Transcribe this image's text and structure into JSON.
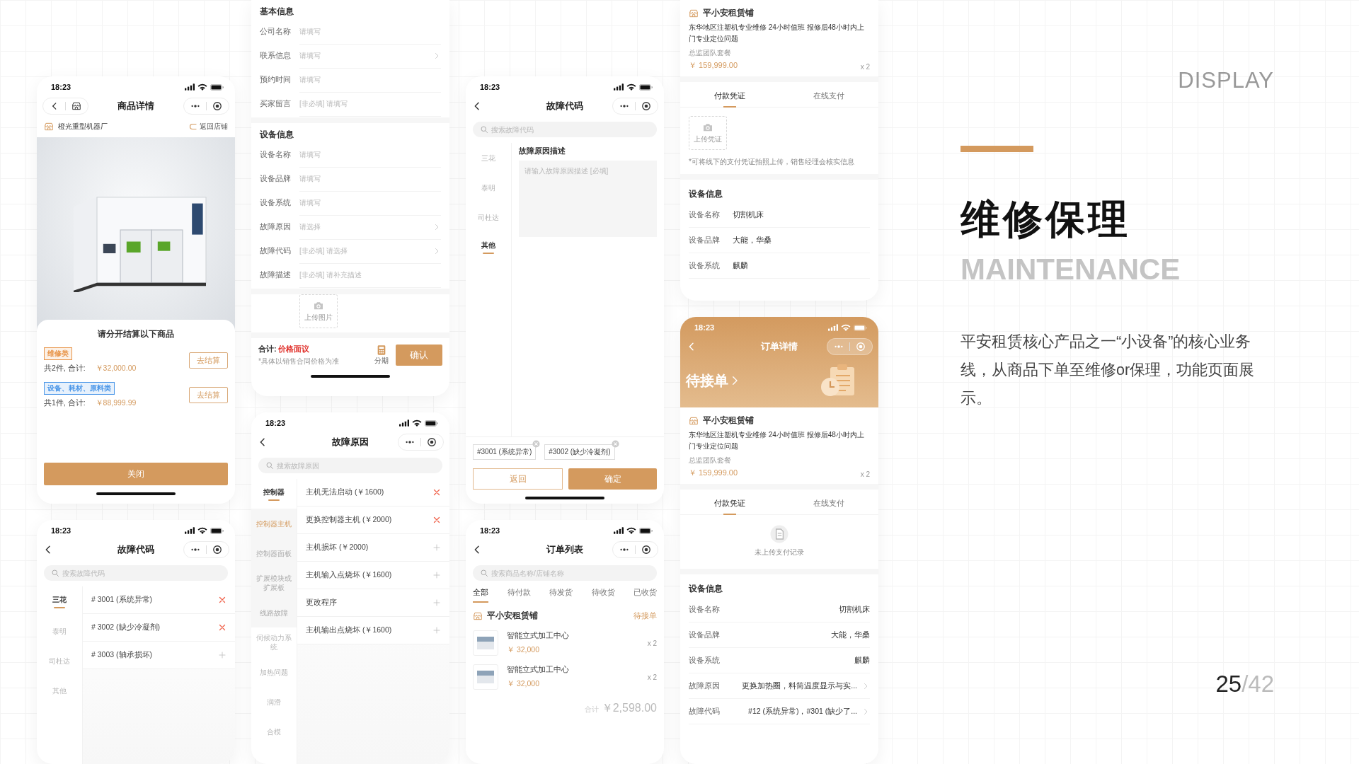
{
  "columns": [
    {
      "screens": [
        {
          "kind": "product_detail",
          "time": "18:23",
          "nav_title": "商品详情",
          "shop": "橙光重型机器厂",
          "back_link": "返回店铺",
          "sheet_title": "请分开结算以下商品",
          "groups": [
            {
              "tag": "维修类",
              "color": "#e8954a",
              "summary": "共2件, 合计:",
              "price": "￥32,000.00",
              "button": "去结算"
            },
            {
              "tag": "设备、耗材、原料类",
              "color": "#4a96e8",
              "summary": "共1件, 合计:",
              "price": "￥88,999.99",
              "button": "去结算"
            }
          ],
          "close": "关闭"
        },
        {
          "kind": "category_list",
          "time": "18:23",
          "nav_title": "故障代码",
          "search": {
            "placeholder": "搜索故障代码"
          },
          "categories": [
            {
              "label": "三花",
              "selected": true
            },
            {
              "label": "泰明",
              "selected": false
            },
            {
              "label": "司杜达",
              "selected": false
            },
            {
              "label": "其他",
              "selected": false
            }
          ],
          "items": [
            {
              "label": "# 3001 (系统异常)",
              "selected": true
            },
            {
              "label": "# 3002 (缺少冷凝剂)",
              "selected": true
            },
            {
              "label": "# 3003 (轴承损坏)",
              "selected": false
            }
          ]
        }
      ]
    },
    {
      "screens": [
        {
          "kind": "form",
          "sections": [
            {
              "title": "基本信息",
              "fields": [
                {
                  "label": "公司名称",
                  "placeholder": "请填写",
                  "arrow": false
                },
                {
                  "label": "联系信息",
                  "placeholder": "请填写",
                  "arrow": true
                },
                {
                  "label": "预约时间",
                  "placeholder": "请填写",
                  "arrow": false
                },
                {
                  "label": "买家留言",
                  "placeholder": "[非必填] 请填写",
                  "arrow": false
                }
              ]
            },
            {
              "title": "设备信息",
              "fields": [
                {
                  "label": "设备名称",
                  "placeholder": "请填写",
                  "arrow": false
                },
                {
                  "label": "设备品牌",
                  "placeholder": "请填写",
                  "arrow": false
                },
                {
                  "label": "设备系统",
                  "placeholder": "请填写",
                  "arrow": false
                },
                {
                  "label": "故障原因",
                  "placeholder": "请选择",
                  "arrow": true
                },
                {
                  "label": "故障代码",
                  "placeholder": "[非必填] 请选择",
                  "arrow": true
                },
                {
                  "label": "故障描述",
                  "placeholder": "[非必填] 请补充描述",
                  "arrow": false
                }
              ]
            }
          ],
          "upload": "上传图片",
          "total_label": "合计:",
          "total_value": "价格面议",
          "note": "*具体以销售合同价格为准",
          "installment": "分期",
          "confirm": "确认"
        },
        {
          "kind": "category_list",
          "time": "18:23",
          "nav_title": "故障原因",
          "search": {
            "placeholder": "搜索故障原因"
          },
          "categories": [
            {
              "label": "控制器",
              "selected": true,
              "children": [
                {
                  "label": "控制器主机",
                  "selected": true
                },
                {
                  "label": "控制器面板",
                  "selected": false
                },
                {
                  "label": "扩展模块或扩展板",
                  "selected": false
                },
                {
                  "label": "线路故障",
                  "selected": false
                }
              ]
            },
            {
              "label": "伺候动力系统",
              "selected": false
            },
            {
              "label": "加热问题",
              "selected": false
            },
            {
              "label": "润滑",
              "selected": false
            },
            {
              "label": "合模",
              "selected": false
            }
          ],
          "items": [
            {
              "label": "主机无法启动 (￥1600)",
              "selected": true
            },
            {
              "label": "更换控制器主机 (￥2000)",
              "selected": true
            },
            {
              "label": "主机损坏 (￥2000)",
              "selected": false
            },
            {
              "label": "主机输入点烧坏 (￥1600)",
              "selected": false
            },
            {
              "label": "更改程序",
              "selected": false
            },
            {
              "label": "主机输出点烧坏 (￥1600)",
              "selected": false
            }
          ]
        }
      ]
    },
    {
      "screens": [
        {
          "kind": "code_custom",
          "time": "18:23",
          "nav_title": "故障代码",
          "search": {
            "placeholder": "搜索故障代码"
          },
          "categories": [
            {
              "label": "三花",
              "selected": false
            },
            {
              "label": "泰明",
              "selected": false
            },
            {
              "label": "司杜达",
              "selected": false
            },
            {
              "label": "其他",
              "selected": true
            }
          ],
          "desc_title": "故障原因描述",
          "desc": {
            "placeholder": "请输入故障原因描述 [必填]"
          },
          "chips": [
            "#3001 (系统异常)",
            "#3002 (缺少冷凝剂)"
          ],
          "back": "返回",
          "confirm": "确定"
        },
        {
          "kind": "order_list",
          "time": "18:23",
          "nav_title": "订单列表",
          "search": {
            "placeholder": "搜索商品名称/店铺名称"
          },
          "tabs": [
            {
              "label": "全部",
              "selected": true
            },
            {
              "label": "待付款",
              "selected": false
            },
            {
              "label": "待发货",
              "selected": false
            },
            {
              "label": "待收货",
              "selected": false
            },
            {
              "label": "已收货",
              "selected": false
            }
          ],
          "shop": "平小安租赁铺",
          "status": "待接单",
          "items": [
            {
              "name": "智能立式加工中心",
              "price": "￥ 32,000",
              "qty": "x 2"
            },
            {
              "name": "智能立式加工中心",
              "price": "￥ 32,000",
              "qty": "x 2"
            }
          ],
          "total_label": "合计",
          "total": "￥2,598.00"
        }
      ]
    },
    {
      "screens": [
        {
          "kind": "order_payment",
          "shop": "平小安租赁铺",
          "desc": "东华地区注塑机专业维修 24小时值班 报修后48小时内上门专业定位问题",
          "package": "总监团队套餐",
          "price": "￥ 159,999.00",
          "qty": "x 2",
          "pay_tabs": [
            {
              "label": "付款凭证",
              "selected": true
            },
            {
              "label": "在线支付",
              "selected": false
            }
          ],
          "upload": "上传凭证",
          "pay_note": "*可将线下的支付凭证拍照上传，销售经理会核实信息",
          "info_title": "设备信息",
          "info": [
            {
              "label": "设备名称",
              "value": "切割机床",
              "arrow": false
            },
            {
              "label": "设备品牌",
              "value": "大能，华桑",
              "arrow": false
            },
            {
              "label": "设备系统",
              "value": "麒麟",
              "arrow": false
            }
          ]
        },
        {
          "kind": "order_detail",
          "time": "18:23",
          "nav_title": "订单详情",
          "header_status": "待接单",
          "shop": "平小安租赁铺",
          "desc": "东华地区注塑机专业维修 24小时值班 报修后48小时内上门专业定位问题",
          "package": "总监团队套餐",
          "price": "￥ 159,999.00",
          "qty": "x 2",
          "pay_tabs": [
            {
              "label": "付款凭证",
              "selected": true
            },
            {
              "label": "在线支付",
              "selected": false
            }
          ],
          "empty_note": "未上传支付记录",
          "info_title": "设备信息",
          "info": [
            {
              "label": "设备名称",
              "value": "切割机床",
              "arrow": false
            },
            {
              "label": "设备品牌",
              "value": "大能，华桑",
              "arrow": false
            },
            {
              "label": "设备系统",
              "value": "麒麟",
              "arrow": false
            },
            {
              "label": "故障原因",
              "value": "更换加热圈，料筒温度显示与实...",
              "arrow": true
            },
            {
              "label": "故障代码",
              "value": "#12 (系统异常)，#301 (缺少了...",
              "arrow": true
            }
          ]
        }
      ]
    }
  ],
  "info_panel": {
    "label": "DISPLAY",
    "title": "维修保理",
    "subtitle": "MAINTENANCE",
    "description": "平安租赁核心产品之一“小设备”的核心业务线，从商品下单至维修or保理，功能页面展示。",
    "page_current": "25",
    "page_total": "/42"
  }
}
